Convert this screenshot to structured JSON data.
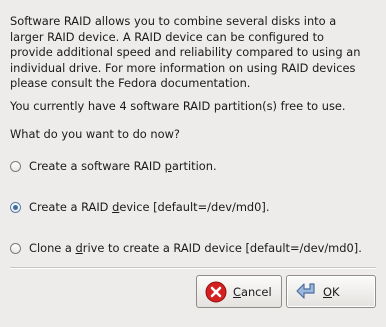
{
  "intro_lines": [
    "Software RAID allows you to combine several disks into a",
    "larger RAID device.  A RAID device can be configured to",
    "provide additional speed and reliability compared to using an",
    "individual drive.  For more information on using RAID devices",
    "please consult the Fedora documentation."
  ],
  "free_text": "You currently have 4 software RAID partition(s) free to use.",
  "question": "What do you want to do now?",
  "options": [
    {
      "pre": "Create a software RAID ",
      "mnemonic": "p",
      "post": "artition.",
      "selected": false
    },
    {
      "pre": "Create a RAID ",
      "mnemonic": "d",
      "post": "evice [default=/dev/md0].",
      "selected": true
    },
    {
      "pre": "Clone a ",
      "mnemonic": "d",
      "post": "rive to create a RAID device [default=/dev/md0].",
      "selected": false
    }
  ],
  "buttons": {
    "cancel": {
      "mnemonic": "C",
      "rest": "ancel",
      "icon": "cancel-icon"
    },
    "ok": {
      "mnemonic": "O",
      "rest": "K",
      "icon": "ok-arrow-icon"
    }
  },
  "colors": {
    "background": "#edeceb",
    "cancel_icon": "#d42020",
    "ok_icon": "#7a9cc8"
  }
}
